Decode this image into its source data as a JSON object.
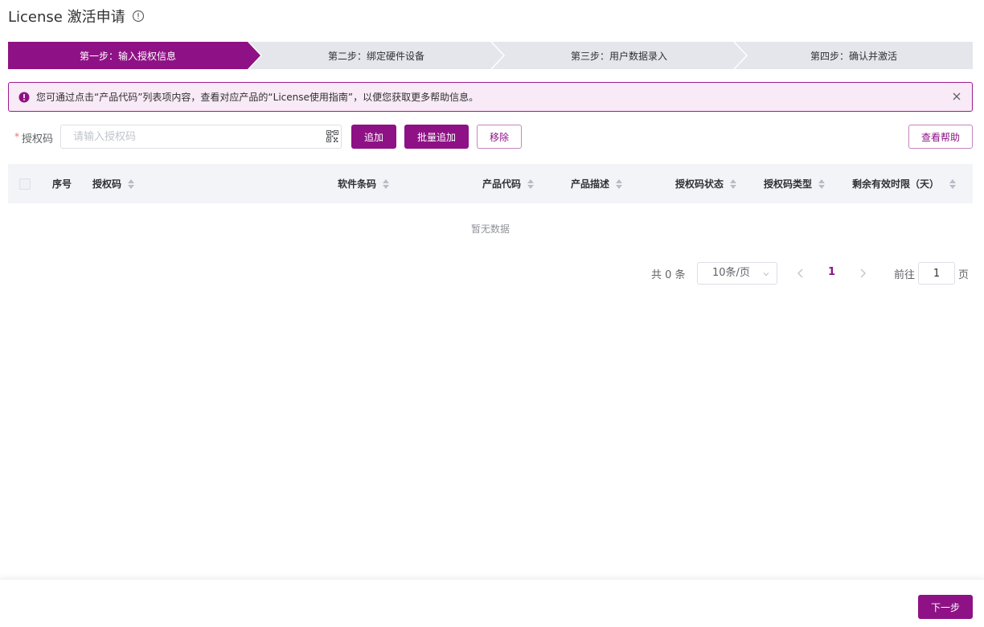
{
  "header": {
    "title": "License 激活申请",
    "info_icon": "info-circle-icon"
  },
  "steps": [
    {
      "label": "第一步：输入授权信息",
      "active": true
    },
    {
      "label": "第二步：绑定硬件设备",
      "active": false
    },
    {
      "label": "第三步：用户数据录入",
      "active": false
    },
    {
      "label": "第四步：确认并激活",
      "active": false
    }
  ],
  "alert": {
    "text": "您可通过点击“产品代码”列表项内容，查看对应产品的“License使用指南”，以便您获取更多帮助信息。",
    "icon": "exclamation-circle-icon",
    "close_icon": "close-icon"
  },
  "form": {
    "label": "授权码",
    "required_mark": "*",
    "input_value": "",
    "input_placeholder": "请输入授权码",
    "qr_icon": "qrcode-icon",
    "add_label": "追加",
    "batch_add_label": "批量追加",
    "remove_label": "移除",
    "help_label": "查看帮助"
  },
  "table": {
    "columns": [
      "序号",
      "授权码",
      "软件条码",
      "产品代码",
      "产品描述",
      "授权码状态",
      "授权码类型",
      "剩余有效时限（天）"
    ],
    "rows": [],
    "empty_text": "暂无数据"
  },
  "pagination": {
    "total_text": "共 0 条",
    "page_size": "10条/页",
    "current_page": "1",
    "goto_label": "前往",
    "goto_value": "1",
    "page_suffix": "页"
  },
  "footer": {
    "next_label": "下一步"
  },
  "colors": {
    "primary": "#8e1285",
    "alert_bg": "#f8eaf6",
    "step_inactive": "#e4e6ec",
    "table_header": "#f3f4f8"
  }
}
